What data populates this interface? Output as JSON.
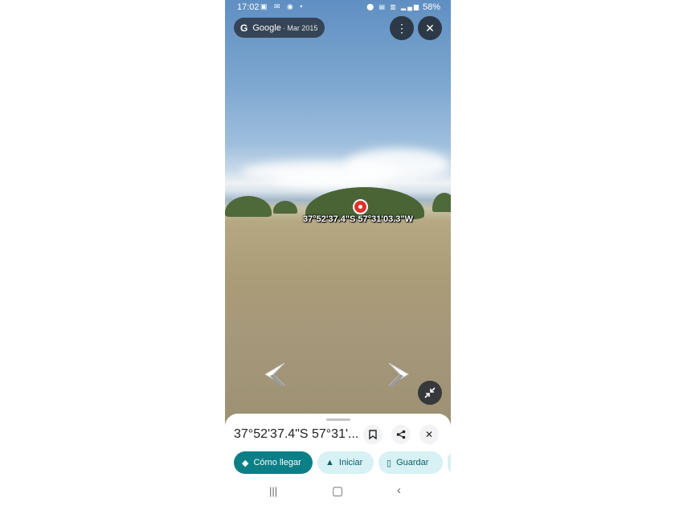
{
  "status_bar": {
    "time": "17:02",
    "battery": "58%",
    "left_icons": [
      "image-icon",
      "mail-icon",
      "whatsapp-icon",
      "dot-icon"
    ],
    "right_icons": [
      "location-icon",
      "volte-icon",
      "4g-icon",
      "signal-icon",
      "battery-icon"
    ]
  },
  "imagery_header": {
    "brand": "Google",
    "capture_date": "· Mar 2015"
  },
  "map": {
    "coordinate_label": "37°52'37.4\"S 57°31'03.3\"W"
  },
  "bottom_sheet": {
    "title": "37°52'37.4\"S 57°31'...",
    "actions": [
      {
        "label": "Cómo llegar",
        "icon": "directions-icon"
      },
      {
        "label": "Iniciar",
        "icon": "navigation-arrow-icon"
      },
      {
        "label": "Guardar",
        "icon": "bookmark-icon"
      }
    ]
  },
  "colors": {
    "primary_chip": "#0b7f86",
    "secondary_chip": "#d7f1f4",
    "marker": "#e0312b"
  }
}
